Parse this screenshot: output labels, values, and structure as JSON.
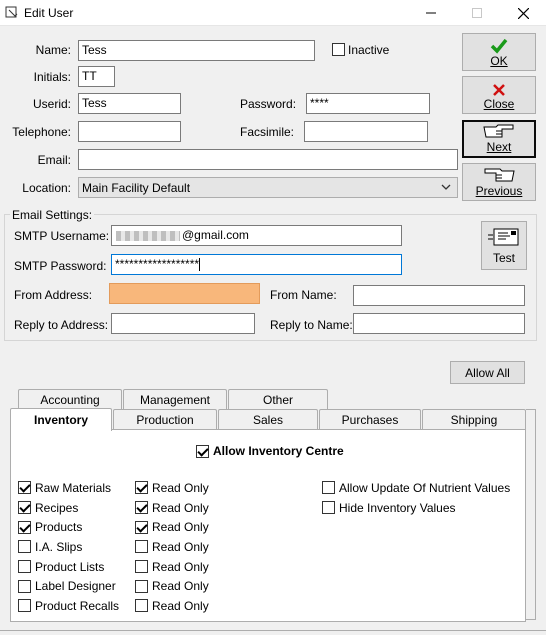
{
  "window": {
    "title": "Edit User"
  },
  "fields": {
    "name_label": "Name:",
    "name_value": "Tess",
    "inactive_label": "Inactive",
    "initials_label": "Initials:",
    "initials_value": "TT",
    "userid_label": "Userid:",
    "userid_value": "Tess",
    "password_label": "Password:",
    "password_value": "****",
    "telephone_label": "Telephone:",
    "telephone_value": "",
    "facsimile_label": "Facsimile:",
    "facsimile_value": "",
    "email_label": "Email:",
    "email_value": "",
    "location_label": "Location:",
    "location_value": "Main Facility Default"
  },
  "buttons": {
    "ok": "OK",
    "close": "Close",
    "next": "Next",
    "previous": "Previous",
    "test": "Test",
    "allow_all": "Allow All"
  },
  "email_settings": {
    "group_label": "Email Settings:",
    "smtp_username_label": "SMTP Username:",
    "smtp_username_value": "@gmail.com",
    "smtp_password_label": "SMTP Password:",
    "smtp_password_value": "******************",
    "from_address_label": "From Address:",
    "from_address_value": "",
    "from_name_label": "From Name:",
    "from_name_value": "",
    "reply_address_label": "Reply to Address:",
    "reply_address_value": "",
    "reply_name_label": "Reply to Name:",
    "reply_name_value": ""
  },
  "tabs_back": [
    "Accounting",
    "Management",
    "Other"
  ],
  "tabs_front": [
    "Inventory",
    "Production",
    "Sales",
    "Purchases",
    "Shipping"
  ],
  "selected_tab": "Inventory",
  "inventory": {
    "allow_centre_label": "Allow Inventory Centre",
    "allow_centre_checked": true,
    "items": [
      {
        "label": "Raw Materials",
        "checked": true,
        "readonly_label": "Read Only",
        "readonly_checked": true
      },
      {
        "label": "Recipes",
        "checked": true,
        "readonly_label": "Read Only",
        "readonly_checked": true
      },
      {
        "label": "Products",
        "checked": true,
        "readonly_label": "Read Only",
        "readonly_checked": true
      },
      {
        "label": "I.A. Slips",
        "checked": false,
        "readonly_label": "Read Only",
        "readonly_checked": false
      },
      {
        "label": "Product Lists",
        "checked": false,
        "readonly_label": "Read Only",
        "readonly_checked": false
      },
      {
        "label": "Label Designer",
        "checked": false,
        "readonly_label": "Read Only",
        "readonly_checked": false
      },
      {
        "label": "Product Recalls",
        "checked": false,
        "readonly_label": "Read Only",
        "readonly_checked": false
      }
    ],
    "extra": [
      {
        "label": "Allow Update Of Nutrient Values",
        "checked": false
      },
      {
        "label": "Hide Inventory Values",
        "checked": false
      }
    ]
  },
  "colors": {
    "ok_check": "#1a9a1a",
    "close_x": "#d01010",
    "highlight_field": "#f8b77b",
    "focus_border": "#0078d7"
  }
}
